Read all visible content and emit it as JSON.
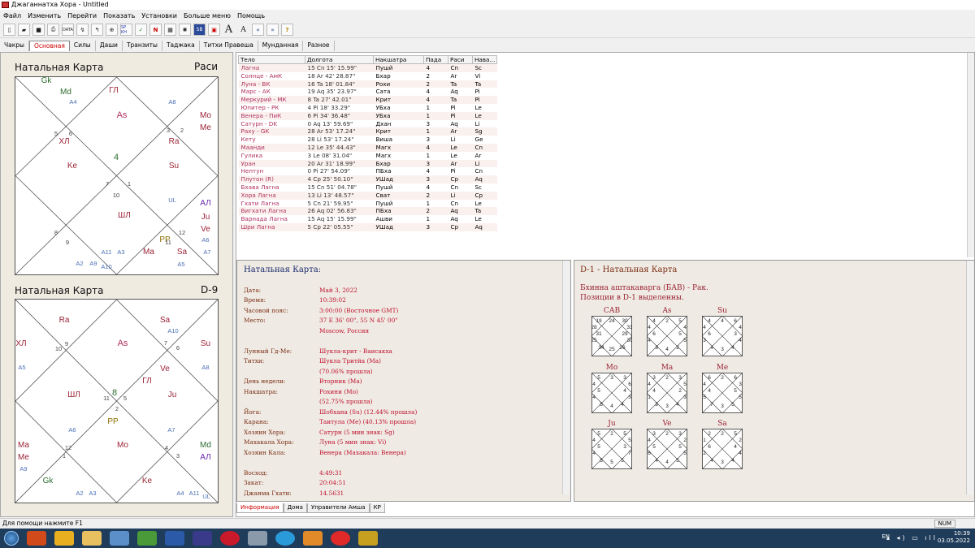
{
  "window": {
    "title": "Джаганнатха Хора - Untitled"
  },
  "menu": [
    "Файл",
    "Изменить",
    "Перейти",
    "Показать",
    "Установки",
    "Больше меню",
    "Помощь"
  ],
  "toolbar": [
    "new",
    "open",
    "save",
    "print",
    "data",
    "transit",
    "back",
    "globe",
    "sp-kh",
    "yoga",
    "n-button",
    "grid",
    "sun",
    "sb",
    "chart-frame",
    "font-large",
    "font-small",
    "prev",
    "next",
    "help"
  ],
  "toolbar_labels": {
    "data": "DATA",
    "spkh": "SP KH",
    "n": "N",
    "sb": "SB",
    "fontA": "A",
    "fonta": "A",
    "help": "?"
  },
  "tabs": [
    "Чакры",
    "Основная",
    "Силы",
    "Даши",
    "Транзиты",
    "Таджака",
    "Титхи Правеша",
    "Мунданная",
    "Разное"
  ],
  "active_tab": "Основная",
  "rasi": {
    "title": "Натальная Карта",
    "label": "Раси",
    "labels": [
      {
        "t": "Gk",
        "c": "#2d6b2d",
        "pos": "a"
      },
      {
        "t": "Md",
        "c": "#2d6b2d",
        "pos": "b"
      },
      {
        "t": "A4",
        "c": "#4a6fb5",
        "pos": "c"
      },
      {
        "t": "ГЛ",
        "c": "#9b2335",
        "pos": "d"
      },
      {
        "t": "A8",
        "c": "#4a6fb5",
        "pos": "e"
      },
      {
        "t": "Mo",
        "c": "#9b2335",
        "pos": "f"
      },
      {
        "t": "Me",
        "c": "#9b2335",
        "pos": "g"
      },
      {
        "t": "As",
        "c": "#b03060",
        "pos": "h"
      },
      {
        "t": "ХЛ",
        "c": "#9b2335",
        "pos": "i"
      },
      {
        "t": "Ra",
        "c": "#9b2335",
        "pos": "j"
      },
      {
        "t": "Ke",
        "c": "#9b2335",
        "pos": "k"
      },
      {
        "t": "Su",
        "c": "#9b2335",
        "pos": "l"
      },
      {
        "t": "UL",
        "c": "#4a6fb5",
        "pos": "m"
      },
      {
        "t": "АЛ",
        "c": "#6a2bb0",
        "pos": "n"
      },
      {
        "t": "Ju",
        "c": "#9b2335",
        "pos": "o"
      },
      {
        "t": "Ve",
        "c": "#9b2335",
        "pos": "p"
      },
      {
        "t": "A6",
        "c": "#4a6fb5",
        "pos": "q"
      },
      {
        "t": "ШЛ",
        "c": "#9b2335",
        "pos": "r"
      },
      {
        "t": "PP",
        "c": "#8a6d00",
        "pos": "s"
      },
      {
        "t": "Sa",
        "c": "#9b2335",
        "pos": "t"
      },
      {
        "t": "A7",
        "c": "#4a6fb5",
        "pos": "u"
      },
      {
        "t": "A11",
        "c": "#4a6fb5",
        "pos": "v"
      },
      {
        "t": "A3",
        "c": "#4a6fb5",
        "pos": "w"
      },
      {
        "t": "Ma",
        "c": "#9b2335",
        "pos": "x"
      },
      {
        "t": "A5",
        "c": "#4a6fb5",
        "pos": "y"
      },
      {
        "t": "A2",
        "c": "#4a6fb5",
        "pos": "z"
      },
      {
        "t": "A9",
        "c": "#4a6fb5",
        "pos": "aa"
      },
      {
        "t": "A10",
        "c": "#4a6fb5",
        "pos": "ab"
      }
    ],
    "houses": [
      "5",
      "6",
      "3",
      "2",
      "7",
      "4",
      "1",
      "10",
      "8",
      "9",
      "12",
      "11"
    ]
  },
  "navamsa": {
    "title": "Натальная Карта",
    "label": "D-9",
    "labels": [
      {
        "t": "Ra",
        "c": "#9b2335"
      },
      {
        "t": "Sa",
        "c": "#9b2335"
      },
      {
        "t": "A10",
        "c": "#4a6fb5"
      },
      {
        "t": "ХЛ",
        "c": "#9b2335"
      },
      {
        "t": "As",
        "c": "#b03060"
      },
      {
        "t": "Su",
        "c": "#9b2335"
      },
      {
        "t": "A5",
        "c": "#4a6fb5"
      },
      {
        "t": "Ve",
        "c": "#9b2335"
      },
      {
        "t": "A8",
        "c": "#4a6fb5"
      },
      {
        "t": "ГЛ",
        "c": "#9b2335"
      },
      {
        "t": "ШЛ",
        "c": "#9b2335"
      },
      {
        "t": "Ju",
        "c": "#9b2335"
      },
      {
        "t": "PP",
        "c": "#8a6d00"
      },
      {
        "t": "A6",
        "c": "#4a6fb5"
      },
      {
        "t": "A7",
        "c": "#4a6fb5"
      },
      {
        "t": "Ma",
        "c": "#9b2335"
      },
      {
        "t": "Me",
        "c": "#9b2335"
      },
      {
        "t": "A9",
        "c": "#4a6fb5"
      },
      {
        "t": "Mo",
        "c": "#9b2335"
      },
      {
        "t": "Md",
        "c": "#2d6b2d"
      },
      {
        "t": "АЛ",
        "c": "#6a2bb0"
      },
      {
        "t": "Gk",
        "c": "#2d6b2d"
      },
      {
        "t": "Ke",
        "c": "#9b2335"
      },
      {
        "t": "A2",
        "c": "#4a6fb5"
      },
      {
        "t": "A3",
        "c": "#4a6fb5"
      },
      {
        "t": "A4",
        "c": "#4a6fb5"
      },
      {
        "t": "A11",
        "c": "#4a6fb5"
      },
      {
        "t": "UL",
        "c": "#4a6fb5"
      }
    ],
    "houses": [
      "9",
      "10",
      "7",
      "6",
      "11",
      "8",
      "5",
      "2",
      "12",
      "1",
      "4",
      "3"
    ]
  },
  "planets": {
    "headers": [
      "Тело",
      "Долгота",
      "Накшатра",
      "Пада",
      "Раси",
      "Нава..."
    ],
    "rows": [
      [
        "Лагна",
        "15 Cn 15' 15.99\"",
        "Пушй",
        "4",
        "Cn",
        "Sc"
      ],
      [
        "Солнце - АмК",
        "18 Ar 42' 28.87\"",
        "Бхар",
        "2",
        "Ar",
        "Vi"
      ],
      [
        "Луна - ВК",
        "16 Ta 18' 01.84\"",
        "Рохи",
        "2",
        "Ta",
        "Ta"
      ],
      [
        "Марс - АК",
        "19 Aq 35' 23.97\"",
        "Сата",
        "4",
        "Aq",
        "Pi"
      ],
      [
        "Меркурий - МК",
        "8 Ta 27' 42.01\"",
        "Крит",
        "4",
        "Ta",
        "Pi"
      ],
      [
        "Юпитер - РК",
        "4 Pi 18' 33.29\"",
        "УБха",
        "1",
        "Pi",
        "Le"
      ],
      [
        "Венера - ПиК",
        "6 Pi 34' 36.48\"",
        "УБха",
        "1",
        "Pi",
        "Le"
      ],
      [
        "Сатурн - DK",
        "0 Aq 13' 59.69\"",
        "Дхан",
        "3",
        "Aq",
        "Li"
      ],
      [
        "Раху - GK",
        "28 Ar 53' 17.24\"",
        "Крит",
        "1",
        "Ar",
        "Sg"
      ],
      [
        "Кету",
        "28 Li 53' 17.24\"",
        "Виша",
        "3",
        "Li",
        "Ge"
      ],
      [
        "Маанди",
        "12 Le 35' 44.43\"",
        "Магх",
        "4",
        "Le",
        "Cn"
      ],
      [
        "Гулика",
        "3 Le 08' 31.04\"",
        "Магх",
        "1",
        "Le",
        "Ar"
      ],
      [
        "Уран",
        "20 Ar 31' 18.99\"",
        "Бхар",
        "3",
        "Ar",
        "Li"
      ],
      [
        "Нептун",
        "0 Pi 27' 54.09\"",
        "ПБха",
        "4",
        "Pi",
        "Cn"
      ],
      [
        "Плутон (R)",
        "4 Cp 25' 50.10\"",
        "УШад",
        "3",
        "Cp",
        "Aq"
      ],
      [
        "Бхава Лагна",
        "15 Cn 51' 04.78\"",
        "Пушй",
        "4",
        "Cn",
        "Sc"
      ],
      [
        "Хора Лагна",
        "13 Li 13' 48.57\"",
        "Сват",
        "2",
        "Li",
        "Cp"
      ],
      [
        "Гхати Лагна",
        "5 Cn 21' 59.95\"",
        "Пушй",
        "1",
        "Cn",
        "Le"
      ],
      [
        "Вигхати Лагна",
        "26 Aq 02' 56.83\"",
        "ПБха",
        "2",
        "Aq",
        "Ta"
      ],
      [
        "Варнада Лагна",
        "15 Aq 15' 15.99\"",
        "Ашви",
        "1",
        "Aq",
        "Le"
      ],
      [
        "Шри Лагна",
        "5 Cp 22' 05.55\"",
        "УШад",
        "3",
        "Cp",
        "Aq"
      ]
    ]
  },
  "info": {
    "title": "Натальная Карта:",
    "rows": [
      {
        "l": "Дата:",
        "v": "Май 3, 2022"
      },
      {
        "l": "Время:",
        "v": "10:39:02"
      },
      {
        "l": "Часовой пояс:",
        "v": "3:00:00 (Восточное GMT)"
      },
      {
        "l": "Место:",
        "v": "37 E 36' 00\", 55 N 45' 00\""
      },
      {
        "l": "",
        "v": "Moscow, Россия"
      },
      {
        "l": "",
        "v": ""
      },
      {
        "l": "Лунный Гд-Ме:",
        "v": "Шукла-крит - Ваисакха"
      },
      {
        "l": "Титхи:",
        "v": "Шукла Тритйа (Ма)"
      },
      {
        "l": "",
        "v": "(70.06% прошла)"
      },
      {
        "l": "День недели:",
        "v": "Вторник (Ма)"
      },
      {
        "l": "Накшатра:",
        "v": "Рохини (Мо)"
      },
      {
        "l": "",
        "v": "(52.75% прошла)"
      },
      {
        "l": "Йога:",
        "v": "Шобхана (Su) (12.44% прошла)"
      },
      {
        "l": "Карана:",
        "v": "Таитула (Ме) (40.13% прошла)"
      },
      {
        "l": "Хозяин Хора:",
        "v": "Сатурн (5 мин знак: Sg)"
      },
      {
        "l": "Махакала Хора:",
        "v": "Луна (5 мин знак: Vi)"
      },
      {
        "l": "Хозяин Кала:",
        "v": "Венера (Махакала: Венера)"
      },
      {
        "l": "",
        "v": ""
      },
      {
        "l": "Восход:",
        "v": "4:49:31"
      },
      {
        "l": "Закат:",
        "v": "20:04:51"
      },
      {
        "l": "Джанма Гхати:",
        "v": "14.5631"
      }
    ]
  },
  "bav": {
    "title": "D-1 - Натальная Карта",
    "subtitle1": "Бхинна аштакаварга (БАВ) - Рак.",
    "subtitle2": "Позиции в D-1 выделенны.",
    "charts": [
      {
        "label": "САВ",
        "v": [
          "24",
          "19",
          "28",
          "31",
          "25",
          "34",
          "25",
          "26",
          "30",
          "29",
          "33",
          "30"
        ]
      },
      {
        "label": "As",
        "v": [
          "2",
          "4",
          "4",
          "6",
          "4",
          "3",
          "4",
          "2",
          "5",
          "5",
          "4",
          "5"
        ]
      },
      {
        "label": "Su",
        "v": [
          "4",
          "4",
          "4",
          "6",
          "3",
          "4",
          "3",
          "4",
          "4",
          "3",
          "4",
          "6"
        ]
      },
      {
        "label": "Mo",
        "v": [
          "3",
          "5",
          "4",
          "5",
          "4",
          "5",
          "4",
          "4",
          "3",
          "4",
          "6",
          "3"
        ]
      },
      {
        "label": "Ma",
        "v": [
          "2",
          "3",
          "4",
          "4",
          "1",
          "3",
          "3",
          "4",
          "3",
          "2",
          "5",
          "3"
        ]
      },
      {
        "label": "Me",
        "v": [
          "2",
          "6",
          "4",
          "4",
          "5",
          "7",
          "3",
          "5",
          "5",
          "5",
          "3",
          "6"
        ]
      },
      {
        "label": "Ju",
        "v": [
          "2",
          "5",
          "4",
          "5",
          "4",
          "5",
          "5",
          "5",
          "7",
          "3",
          "5",
          "5"
        ]
      },
      {
        "label": "Ve",
        "v": [
          "2",
          "3",
          "4",
          "5",
          "6",
          "4",
          "4",
          "5",
          "5",
          "5",
          "2",
          "3"
        ]
      },
      {
        "label": "Sa",
        "v": [
          "2",
          "2",
          "1",
          "6",
          "2",
          "4",
          "3",
          "4",
          "4",
          "4",
          "2",
          "5"
        ]
      }
    ]
  },
  "bottom_tabs": [
    "Информация",
    "Дома",
    "Управители Амша",
    "КР"
  ],
  "bottom_active": "Информация",
  "status": {
    "help": "Для помощи нажмите F1",
    "num": "NUM"
  },
  "tray": {
    "lang": "EN",
    "time": "10:39",
    "date": "03.05.2022"
  },
  "taskbar_icons": [
    "start",
    "power",
    "alert",
    "folder",
    "control",
    "utorrent",
    "word",
    "app-x",
    "opera",
    "calc",
    "telegram",
    "media",
    "yandex",
    "jhora"
  ]
}
